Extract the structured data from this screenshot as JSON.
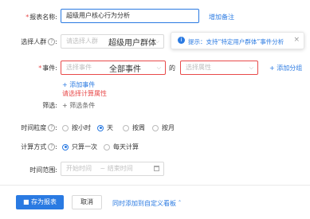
{
  "report_name": {
    "label": "报表名称:",
    "value": "超级用户核心行为分析",
    "add_note": "增加备注"
  },
  "user_group": {
    "label": "选择人群",
    "placeholder": "请选择人群",
    "overlay_text": "超级用户群体"
  },
  "tip": {
    "text": "提示：支持“特定用户群体”事件分析"
  },
  "event": {
    "label": "事件:",
    "placeholder": "选择事件",
    "overlay_text": "全部事件",
    "connector": "的",
    "attr_placeholder": "选择属性",
    "add_group": "添加分组",
    "add_event": "添加事件",
    "error": "请选择计算属性"
  },
  "filter": {
    "label": "筛选:",
    "add_condition": "筛选条件"
  },
  "granularity": {
    "label": "时间粒度",
    "options": [
      "按小时",
      "天",
      "按周",
      "按月"
    ],
    "selected_index": 1
  },
  "calc": {
    "label": "计算方式",
    "options": [
      "只算一次",
      "每天计算"
    ],
    "selected_index": 0
  },
  "time_range": {
    "label": "时间范围:",
    "start_placeholder": "开始时间",
    "separator": "~",
    "end_placeholder": "结束时间"
  },
  "footer": {
    "save": "存为报表",
    "cancel": "取消",
    "add_dashboard": "同时添加到自定义看板"
  },
  "colors": {
    "primary": "#2a7ae2",
    "error": "#e84a4a"
  }
}
